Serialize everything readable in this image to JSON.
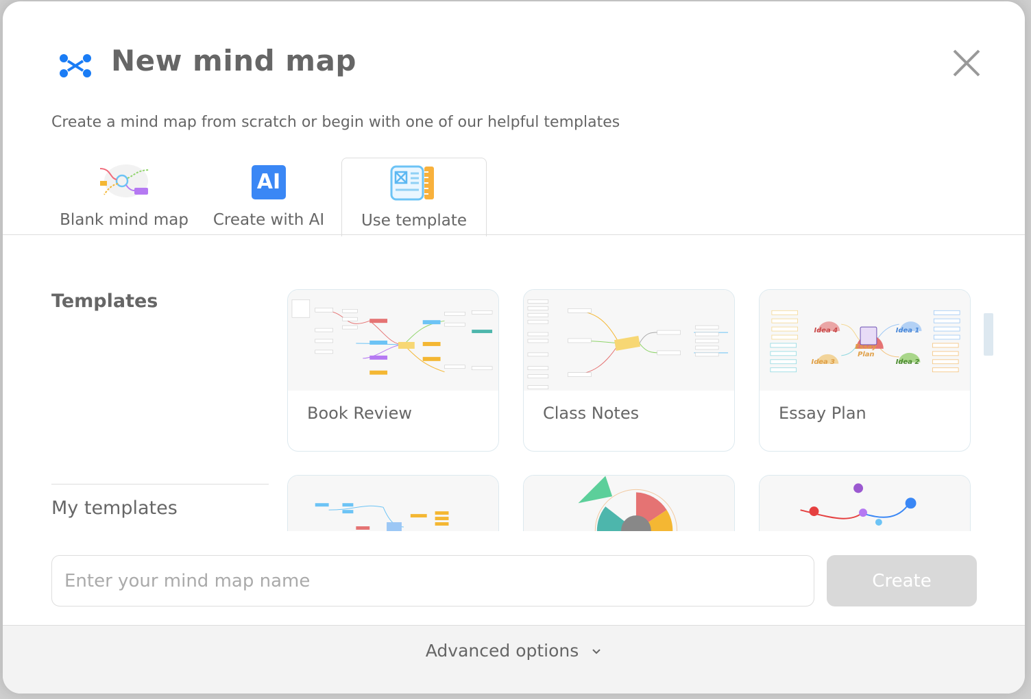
{
  "dialog": {
    "title": "New mind map",
    "subtitle": "Create a mind map from scratch or begin with one of our helpful templates",
    "brand_color": "#1a7cf5"
  },
  "tabs": [
    {
      "label": "Blank mind map",
      "icon": "blank-map-icon"
    },
    {
      "label": "Create with AI",
      "icon": "ai-icon",
      "icon_text": "AI"
    },
    {
      "label": "Use template",
      "icon": "template-icon",
      "active": true
    }
  ],
  "sections": {
    "templates": "Templates",
    "my_templates": "My templates"
  },
  "templates": [
    {
      "label": "Book Review"
    },
    {
      "label": "Class Notes"
    },
    {
      "label": "Essay Plan"
    }
  ],
  "name_input": {
    "placeholder": "Enter your mind map name",
    "value": ""
  },
  "create_label": "Create",
  "advanced_label": "Advanced options"
}
